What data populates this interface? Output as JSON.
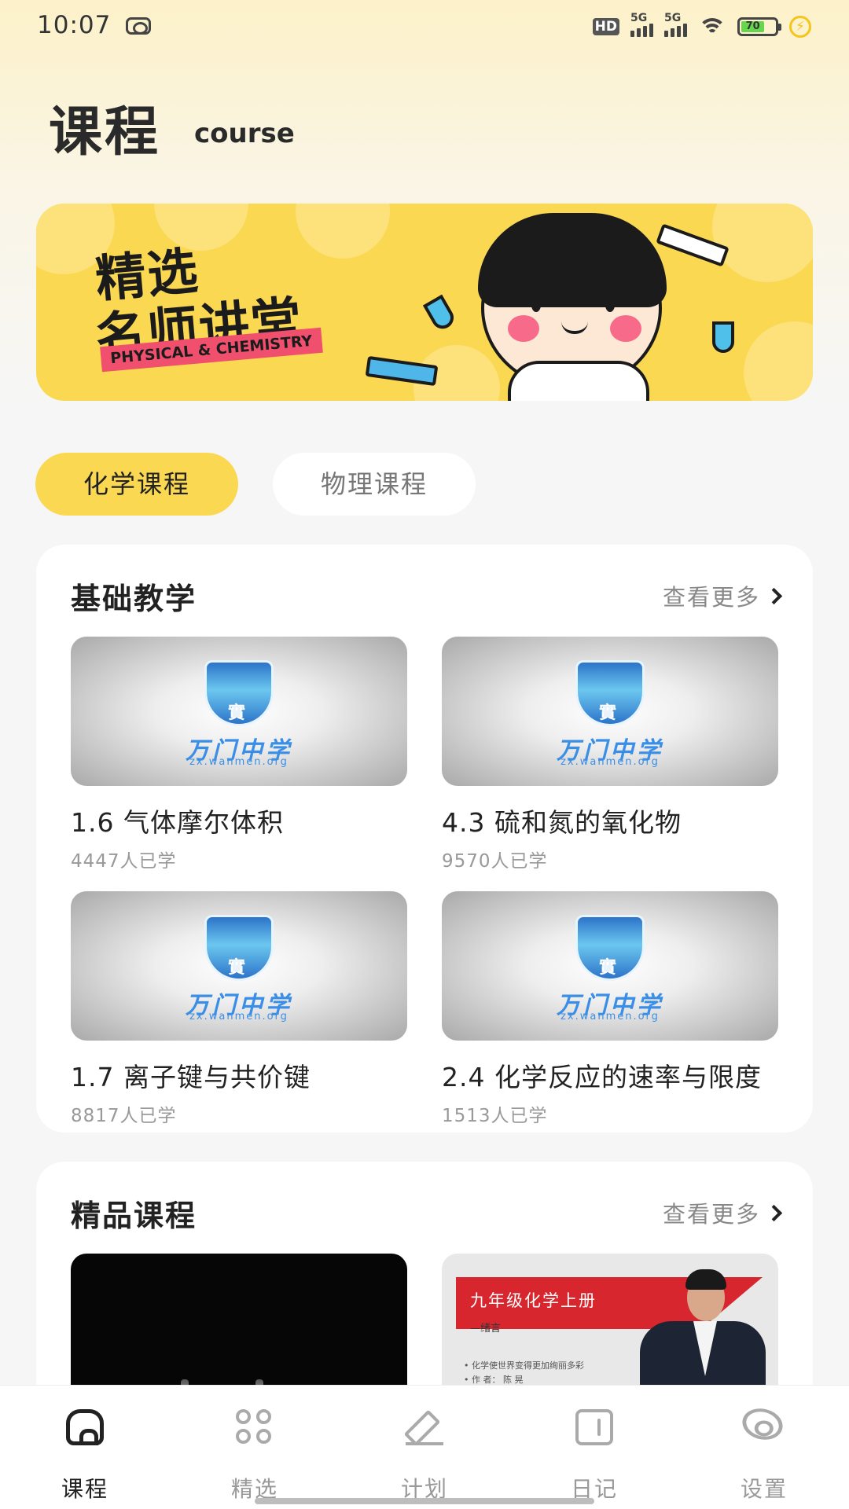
{
  "status_bar": {
    "time": "10:07",
    "hd_label": "HD",
    "signal1_label": "5G",
    "signal2_label": "5G",
    "battery_level": "70",
    "battery_fraction": 0.7
  },
  "header": {
    "title": "课程",
    "subtitle": "course"
  },
  "banner": {
    "line1": "精选",
    "line2": "名师讲堂",
    "tag": "PHYSICAL & CHEMISTRY"
  },
  "tabs": [
    {
      "label": "化学课程",
      "active": true
    },
    {
      "label": "物理课程",
      "active": false
    }
  ],
  "sections": [
    {
      "title": "基础教学",
      "see_more": "查看更多",
      "courses": [
        {
          "name": "1.6 气体摩尔体积",
          "count": "4447人已学",
          "logo": "万门中学",
          "url": "zx.wanmen.org"
        },
        {
          "name": "4.3 硫和氮的氧化物",
          "count": "9570人已学",
          "logo": "万门中学",
          "url": "zx.wanmen.org"
        },
        {
          "name": "1.7 离子键与共价键",
          "count": "8817人已学",
          "logo": "万门中学",
          "url": "zx.wanmen.org"
        },
        {
          "name": "2.4 化学反应的速率与限度",
          "count": "1513人已学",
          "logo": "万门中学",
          "url": "zx.wanmen.org"
        }
      ]
    },
    {
      "title": "精品课程",
      "see_more": "查看更多",
      "lecture": {
        "title": "九年级化学上册",
        "subtitle": "—绪言",
        "bullet1": "• 化学使世界变得更加绚丽多彩",
        "bullet2": "• 作 者： 陈 晃"
      }
    }
  ],
  "bottom_nav": [
    {
      "label": "课程",
      "icon": "home-icon",
      "active": true
    },
    {
      "label": "精选",
      "icon": "grid-icon",
      "active": false
    },
    {
      "label": "计划",
      "icon": "pen-icon",
      "active": false
    },
    {
      "label": "日记",
      "icon": "diary-icon",
      "active": false
    },
    {
      "label": "设置",
      "icon": "eye-icon",
      "active": false
    }
  ],
  "colors": {
    "accent": "#fbd852",
    "text": "#222222",
    "muted": "#999999"
  }
}
